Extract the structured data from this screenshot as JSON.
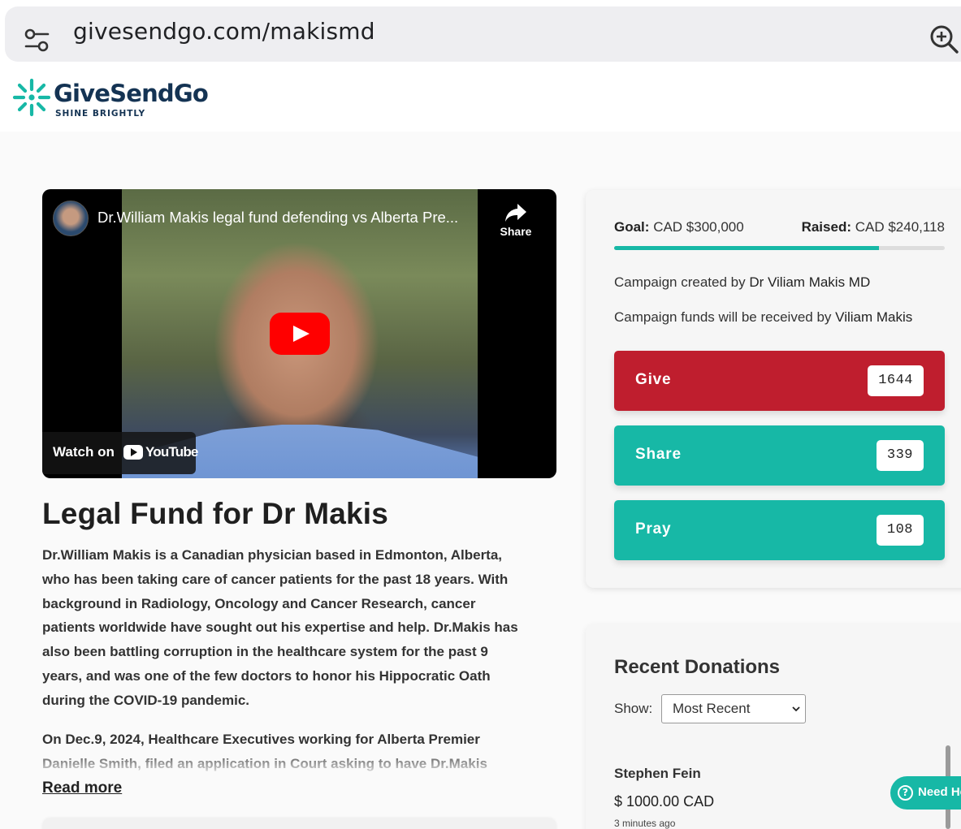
{
  "browser": {
    "url": "givesendgo.com/makismd"
  },
  "site": {
    "logo_text": "GiveSendGo",
    "tagline": "SHINE BRIGHTLY",
    "brand_color": "#17b8a6",
    "navy": "#143353"
  },
  "video": {
    "title": "Dr.William Makis legal fund defending vs Alberta Pre...",
    "share_label": "Share",
    "watch_on_label": "Watch on",
    "youtube_label": "YouTube"
  },
  "campaign": {
    "title": "Legal Fund for Dr Makis",
    "paragraph1": "Dr.William Makis is a Canadian physician based in Edmonton, Alberta, who has been taking care of cancer patients for the past 18 years. With background in Radiology, Oncology and Cancer Research, cancer patients worldwide have sought out his expertise and help. Dr.Makis has also been battling corruption in the healthcare system for the past 9 years, and was one of the few doctors to honor his Hippocratic Oath during the COVID-19 pandemic.",
    "paragraph2": "On Dec.9, 2024, Healthcare Executives working for Alberta Premier Danielle Smith, filed an application in Court asking to have Dr.Makis",
    "read_more": "Read more"
  },
  "funding": {
    "goal_label": "Goal:",
    "goal_value": "CAD $300,000",
    "raised_label": "Raised:",
    "raised_value": "CAD $240,118",
    "progress_fraction": 0.8004,
    "created_by_prefix": "Campaign created by",
    "created_by_name": "Dr Viliam Makis MD",
    "received_by_prefix": "Campaign funds will be received by",
    "received_by_name": "Viliam Makis"
  },
  "actions": {
    "give_label": "Give",
    "give_count": "1644",
    "give_color": "#bf1e2e",
    "share_label": "Share",
    "share_count": "339",
    "pray_label": "Pray",
    "pray_count": "108"
  },
  "donations": {
    "title": "Recent Donations",
    "show_label": "Show:",
    "show_selected": "Most Recent",
    "items": [
      {
        "name": "Stephen Fein",
        "amount": "$ 1000.00 CAD",
        "time": "3 minutes ago"
      }
    ]
  },
  "help": {
    "label": "Need Help?"
  }
}
